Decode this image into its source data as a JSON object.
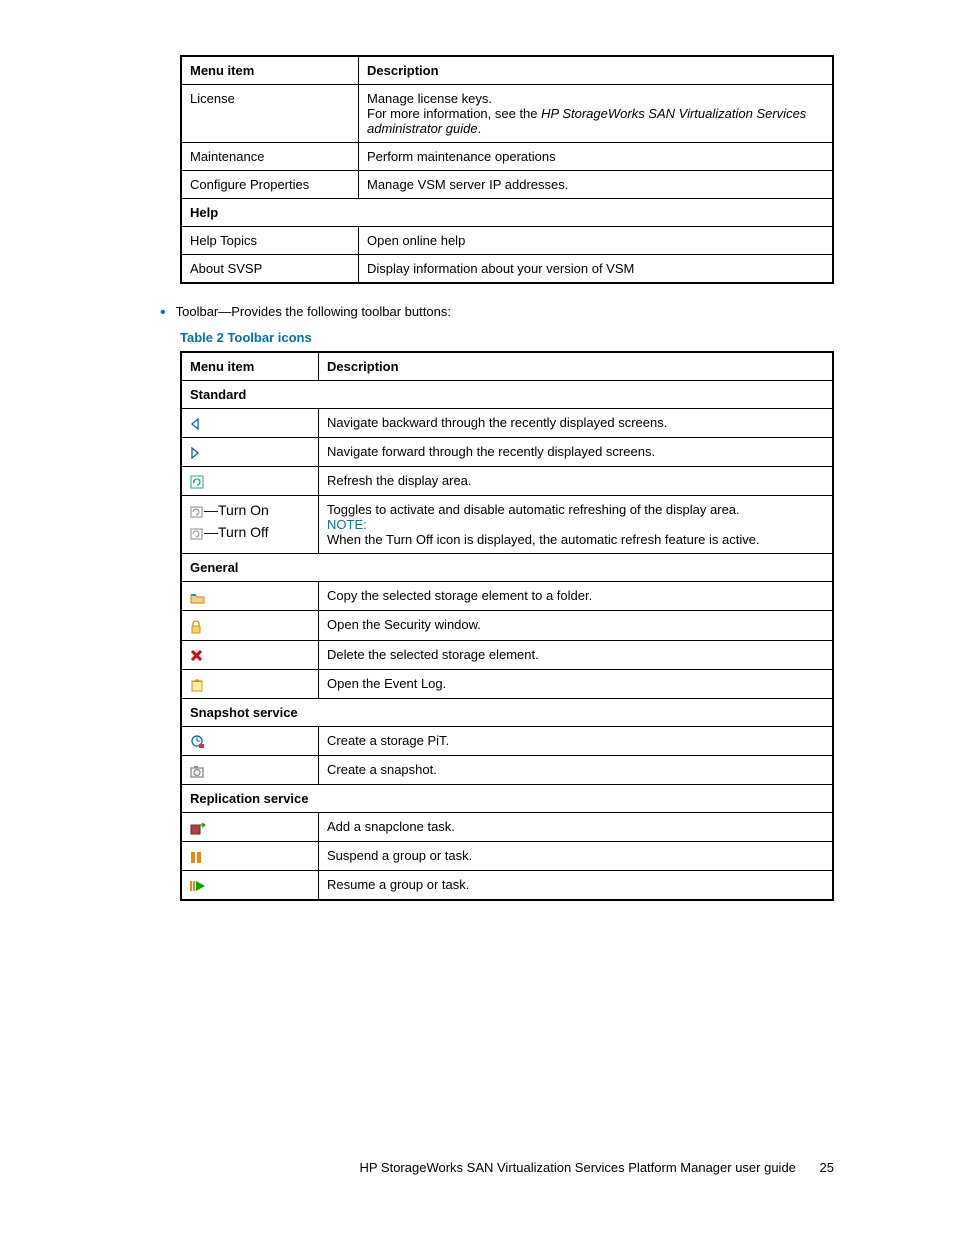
{
  "table1": {
    "headers": {
      "menu": "Menu item",
      "desc": "Description"
    },
    "rows": {
      "license": {
        "menu": "License",
        "desc_line1": "Manage license keys.",
        "desc_line2a": "For more information, see the ",
        "desc_line2_italic": "HP StorageWorks SAN Virtualization Services administrator guide",
        "desc_line2b": "."
      },
      "maintenance": {
        "menu": "Maintenance",
        "desc": "Perform maintenance operations"
      },
      "configprops": {
        "menu": "Configure Properties",
        "desc": "Manage VSM server IP addresses."
      },
      "help_section": "Help",
      "helptopics": {
        "menu": "Help Topics",
        "desc": "Open online help"
      },
      "about": {
        "menu": "About SVSP",
        "desc": "Display information about your version of VSM"
      }
    }
  },
  "bullet_text": "Toolbar—Provides the following toolbar buttons:",
  "table2_caption": "Table 2 Toolbar icons",
  "table2": {
    "headers": {
      "menu": "Menu item",
      "desc": "Description"
    },
    "sections": {
      "standard": "Standard",
      "general": "General",
      "snapshot": "Snapshot service",
      "replication": "Replication service"
    },
    "rows": {
      "back": {
        "desc": "Navigate backward through the recently displayed screens."
      },
      "forward": {
        "desc": "Navigate forward through the recently displayed screens."
      },
      "refresh": {
        "desc": "Refresh the display area."
      },
      "toggle": {
        "turnon": "—Turn On",
        "turnoff": "—Turn Off",
        "desc1": "Toggles to activate and disable automatic refreshing of the display area.",
        "note": "NOTE:",
        "desc2": "When the Turn Off icon is displayed, the automatic refresh feature is active."
      },
      "copy": {
        "desc": "Copy the selected storage element to a folder."
      },
      "security": {
        "desc": "Open the Security window."
      },
      "delete": {
        "desc": "Delete the selected storage element."
      },
      "eventlog": {
        "desc": "Open the Event Log."
      },
      "pit": {
        "desc": "Create a storage PiT."
      },
      "snapshot": {
        "desc": "Create a snapshot."
      },
      "snapclone": {
        "desc": "Add a snapclone task."
      },
      "suspend": {
        "desc": "Suspend a group or task."
      },
      "resume": {
        "desc": "Resume a group or task."
      }
    }
  },
  "footer": {
    "title": "HP StorageWorks SAN Virtualization Services Platform Manager user guide",
    "page": "25"
  }
}
